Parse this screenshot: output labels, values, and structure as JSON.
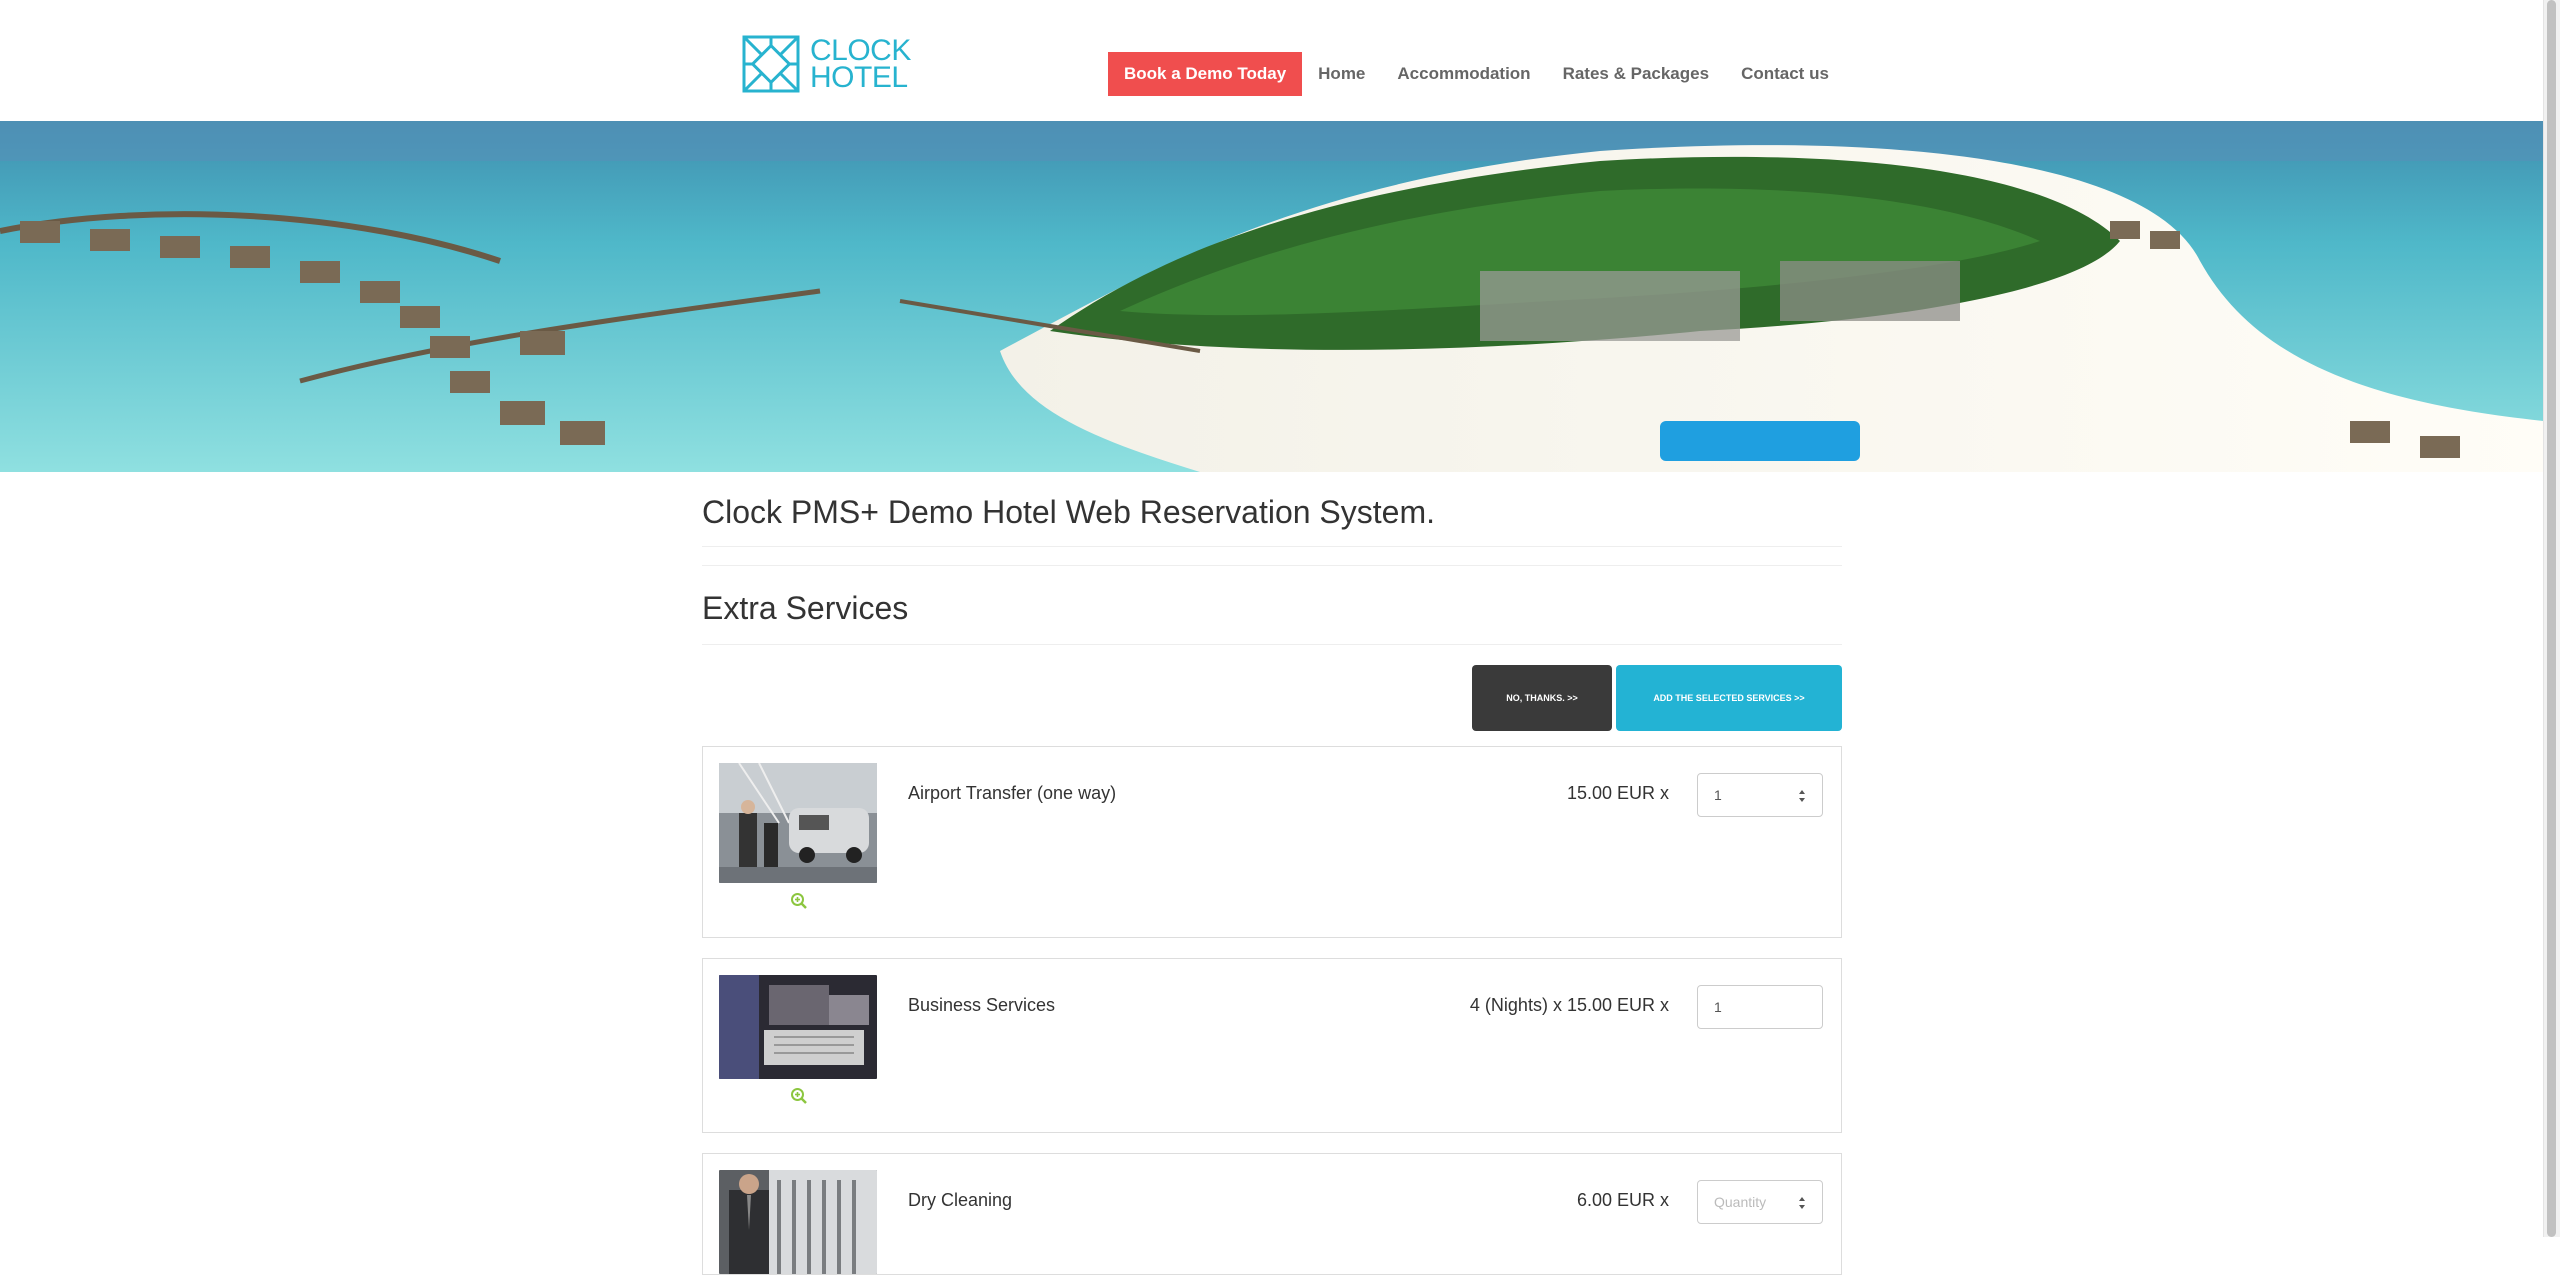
{
  "header": {
    "logo_line1": "CLOCK",
    "logo_line2": "HOTEL",
    "cta_label": "Book a Demo Today",
    "nav": [
      "Home",
      "Accommodation",
      "Rates & Packages",
      "Contact us"
    ]
  },
  "page": {
    "title": "Clock PMS+ Demo Hotel Web Reservation System.",
    "section_title": "Extra Services"
  },
  "actions": {
    "decline_label": "NO, THANKS. >>",
    "accept_label": "ADD THE SELECTED SERVICES >>"
  },
  "services": [
    {
      "name": "Airport Transfer (one way)",
      "price": "15.00 EUR x",
      "quantity": "1",
      "placeholder": "Quantity"
    },
    {
      "name": "Business Services",
      "price": "4 (Nights) x 15.00 EUR x",
      "quantity": "1",
      "placeholder": "Quantity"
    },
    {
      "name": "Dry Cleaning",
      "price": "6.00 EUR x",
      "quantity": "",
      "placeholder": "Quantity"
    }
  ],
  "colors": {
    "brand": "#27b3cf",
    "cta": "#f04e4e",
    "decline_button": "#3a3a3a",
    "accept_button": "#23b3d4",
    "zoom_icon": "#8cc63f"
  }
}
